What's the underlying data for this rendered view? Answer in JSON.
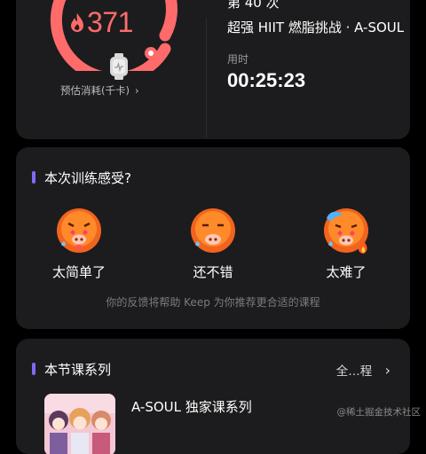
{
  "summary": {
    "calories_value": "371",
    "calories_label": "预估消耗(千卡)",
    "chevron": "›",
    "session_number": "第 40 次",
    "course_title": "超强 HIIT 燃脂挑战 · A-SOUL",
    "time_label": "用时",
    "time_value": "00:25:23",
    "accent_color": "#ff6b6b"
  },
  "feeling": {
    "title": "本次训练感受?",
    "options": [
      {
        "label": "太简单了",
        "icon": "pig-face-easy-icon"
      },
      {
        "label": "还不错",
        "icon": "pig-face-ok-icon"
      },
      {
        "label": "太难了",
        "icon": "pig-face-hard-icon"
      }
    ],
    "hint": "你的反馈将帮助 Keep 为你推荐更合适的课程"
  },
  "series": {
    "title": "本节课系列",
    "all_label": "全…程",
    "chevron": "›",
    "item_name": "A-SOUL 独家课系列"
  },
  "watermark": "@稀土掘金技术社区",
  "colors": {
    "background": "#000000",
    "card": "#1c1c1e",
    "section_bar": "#7b6cf6"
  }
}
